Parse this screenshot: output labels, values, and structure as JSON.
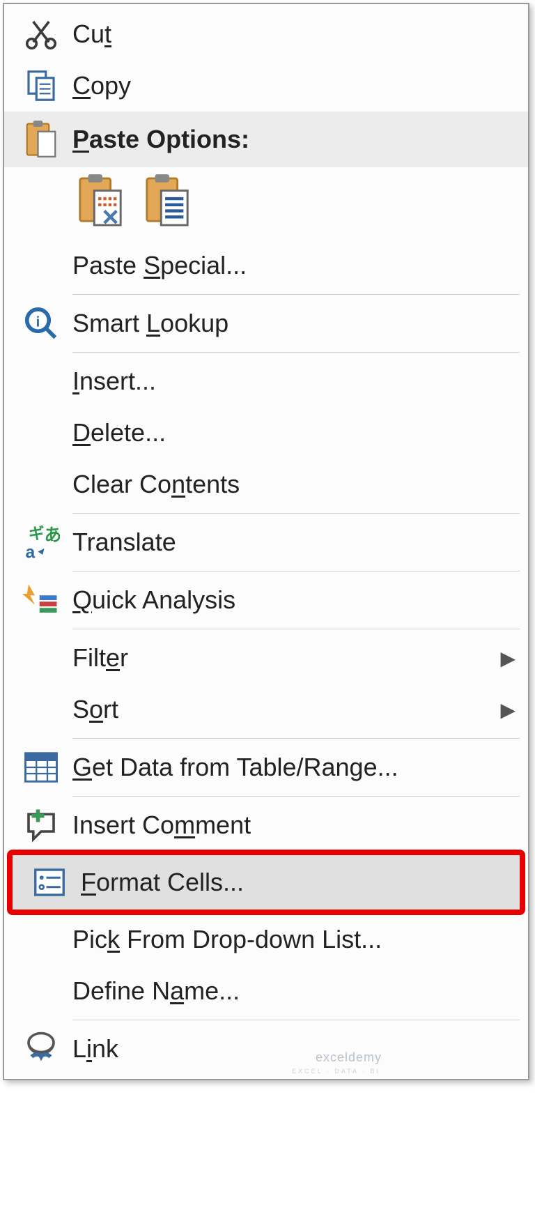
{
  "menu": {
    "cut": {
      "pre": "Cu",
      "u": "t",
      "post": ""
    },
    "copy": {
      "pre": "",
      "u": "C",
      "post": "opy"
    },
    "paste_options": {
      "pre": "",
      "u": "P",
      "post": "aste Options:"
    },
    "paste_special": {
      "pre": "Paste ",
      "u": "S",
      "post": "pecial..."
    },
    "smart_lookup": {
      "pre": "Smart ",
      "u": "L",
      "post": "ookup"
    },
    "insert": {
      "pre": "",
      "u": "I",
      "post": "nsert..."
    },
    "delete": {
      "pre": "",
      "u": "D",
      "post": "elete..."
    },
    "clear_contents": {
      "pre": "Clear Co",
      "u": "n",
      "post": "tents"
    },
    "translate": {
      "pre": "Translate",
      "u": "",
      "post": ""
    },
    "quick_analysis": {
      "pre": "",
      "u": "Q",
      "post": "uick Analysis"
    },
    "filter": {
      "pre": "Filt",
      "u": "e",
      "post": "r"
    },
    "sort": {
      "pre": "S",
      "u": "o",
      "post": "rt"
    },
    "get_data": {
      "pre": "",
      "u": "G",
      "post": "et Data from Table/Range..."
    },
    "insert_comment": {
      "pre": "Insert Co",
      "u": "m",
      "post": "ment"
    },
    "format_cells": {
      "pre": "",
      "u": "F",
      "post": "ormat Cells..."
    },
    "pick_dropdown": {
      "pre": "Pic",
      "u": "k",
      "post": " From Drop-down List..."
    },
    "define_name": {
      "pre": "Define N",
      "u": "a",
      "post": "me..."
    },
    "link": {
      "pre": "L",
      "u": "i",
      "post": "nk"
    }
  },
  "watermark": "exceldemy",
  "watermark_sub": "EXCEL · DATA · BI"
}
